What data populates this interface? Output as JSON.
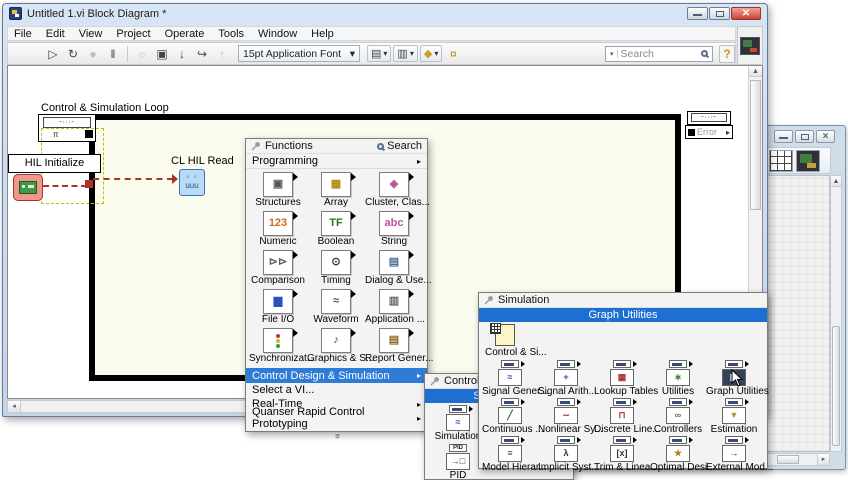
{
  "colors": {
    "highlight_blue": "#2f7cd6",
    "banner_blue": "#1d70d2",
    "loop_fill": "#fbfbee",
    "wire_red": "#b03128",
    "marquee_green": "#b7c400"
  },
  "icons": {
    "run": "▷",
    "run_continuous": "↻",
    "abort": "●",
    "pause": "‖",
    "highlight_execution": "☼",
    "retain_values": "▣",
    "step_into": "↓",
    "step_over": "↪",
    "step_out": "↑",
    "align": "▤",
    "distribute": "▥",
    "reorder": "◆",
    "cleanup": "¤",
    "help": "?",
    "dropdown": "▾",
    "submenu": "▸",
    "more_chevron": "»",
    "scroll_up": "▲",
    "scroll_down": "▼",
    "scroll_left": "◂",
    "scroll_right": "▸",
    "node_dots": "-∙∙∙-",
    "solver": "π",
    "cl_eyes": "◦ ◦",
    "cl_wave": "uuu"
  },
  "main_window": {
    "title": "Untitled 1.vi Block Diagram *",
    "menu": [
      "File",
      "Edit",
      "View",
      "Project",
      "Operate",
      "Tools",
      "Window",
      "Help"
    ],
    "toolbar": {
      "font_selector": "15pt Application Font",
      "search_placeholder": "Search"
    }
  },
  "diagram": {
    "loop_label": "Control & Simulation Loop",
    "hil_initialize": "HIL Initialize",
    "cl_hil_read": "CL HIL Read",
    "error_label": "Error"
  },
  "functions_palette": {
    "title": "Functions",
    "search": "Search",
    "category": "Programming",
    "items": [
      {
        "label": "Structures",
        "glyph": "▣",
        "color": "#555555"
      },
      {
        "label": "Array",
        "glyph": "▦",
        "color": "#b8860b"
      },
      {
        "label": "Cluster, Clas...",
        "glyph": "◈",
        "color": "#b05090"
      },
      {
        "label": "Numeric",
        "glyph": "123",
        "color": "#d2691e"
      },
      {
        "label": "Boolean",
        "glyph": "TF",
        "color": "#1f7a1f"
      },
      {
        "label": "String",
        "glyph": "abc",
        "color": "#c050a0"
      },
      {
        "label": "Comparison",
        "glyph": "⊳⊳",
        "color": "#606060"
      },
      {
        "label": "Timing",
        "glyph": "⊙",
        "color": "#333333"
      },
      {
        "label": "Dialog & Use...",
        "glyph": "▤",
        "color": "#4a6a9a"
      },
      {
        "label": "File I/O",
        "glyph": "▆",
        "color": "#2a52be"
      },
      {
        "label": "Waveform",
        "glyph": "≈",
        "color": "#2a7a2a"
      },
      {
        "label": "Application ...",
        "glyph": "▥",
        "color": "#666666"
      },
      {
        "label": "Synchronizat...",
        "glyph": "",
        "color": "#333333",
        "traffic": true
      },
      {
        "label": "Graphics & S...",
        "glyph": "♪",
        "color": "#a02020"
      },
      {
        "label": "Report Gener...",
        "glyph": "▤",
        "color": "#8a6a1f"
      }
    ],
    "highlighted_item": "Control Design & Simulation",
    "menu_items": [
      {
        "label": "Select a VI..."
      },
      {
        "label": "Real-Time",
        "arrow": "▸"
      },
      {
        "label": "Quanser Rapid Control Prototyping",
        "arrow": "▸"
      }
    ]
  },
  "control_design_palette": {
    "title": "Control D",
    "banner": "Simulation",
    "items": [
      {
        "label": "Simulation",
        "glyph": "≈",
        "color": "#5b3fbf"
      },
      {
        "label": "PID",
        "glyph": "→□",
        "color": "#333333",
        "top_text": "PID"
      }
    ]
  },
  "simulation_palette": {
    "title": "Simulation",
    "banner": "Graph Utilities",
    "featured_item": {
      "label": "Control & Si..."
    },
    "items": [
      {
        "label": "Signal Gener...",
        "glyph": "≈",
        "color": "#2a4f9e"
      },
      {
        "label": "Signal Arith...",
        "glyph": "+",
        "color": "#2a4f9e"
      },
      {
        "label": "Lookup Tables",
        "glyph": "▦",
        "color": "#b03030"
      },
      {
        "label": "Utilities",
        "glyph": "∗",
        "color": "#3a7a2a"
      },
      {
        "label": "Graph Utilities",
        "glyph": "▩",
        "color": "#ffffff",
        "dark": true,
        "cursor": true
      },
      {
        "label": "Continuous ...",
        "glyph": "╱",
        "color": "#2a6a2a"
      },
      {
        "label": "Nonlinear Sy...",
        "glyph": "∼",
        "color": "#a03030"
      },
      {
        "label": "Discrete Line...",
        "glyph": "⊓",
        "color": "#b03030"
      },
      {
        "label": "Controllers",
        "glyph": "∞",
        "color": "#666666"
      },
      {
        "label": "Estimation",
        "glyph": "▼",
        "color": "#b59a2a"
      },
      {
        "label": "Model Hierar...",
        "glyph": "≡",
        "color": "#334466"
      },
      {
        "label": "Implicit Syst...",
        "glyph": "λ",
        "color": "#333333"
      },
      {
        "label": "Trim & Linea...",
        "glyph": "[x]",
        "color": "#333333"
      },
      {
        "label": "Optimal Desi...",
        "glyph": "★",
        "color": "#c07a1f"
      },
      {
        "label": "External Mod...",
        "glyph": "→",
        "color": "#333333"
      }
    ]
  }
}
